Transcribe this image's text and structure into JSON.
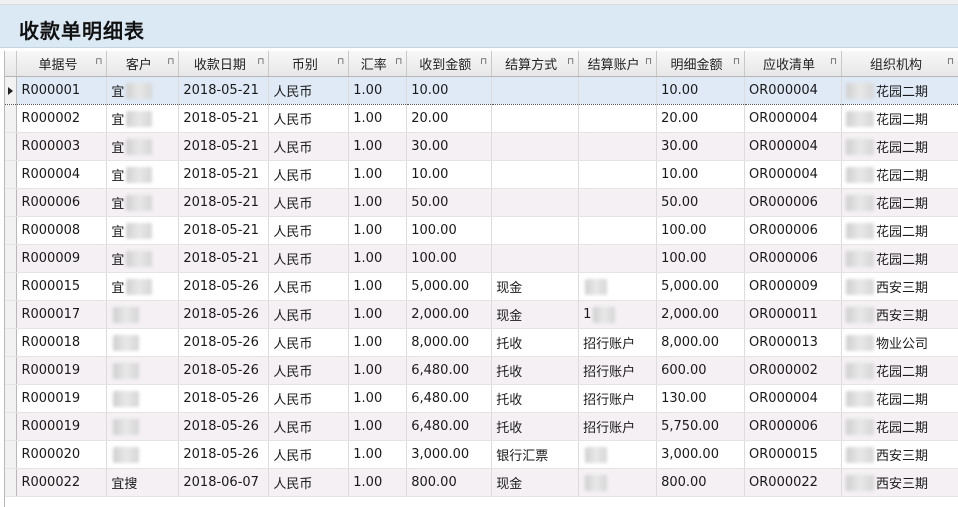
{
  "window": {
    "title": "收款单明细表"
  },
  "columns": [
    {
      "key": "doc_no",
      "label": "单据号"
    },
    {
      "key": "customer",
      "label": "客户"
    },
    {
      "key": "date",
      "label": "收款日期"
    },
    {
      "key": "currency",
      "label": "币别"
    },
    {
      "key": "rate",
      "label": "汇率"
    },
    {
      "key": "received",
      "label": "收到金额"
    },
    {
      "key": "settle_method",
      "label": "结算方式"
    },
    {
      "key": "settle_account",
      "label": "结算账户"
    },
    {
      "key": "detail_amount",
      "label": "明细金额"
    },
    {
      "key": "receivable",
      "label": "应收清单"
    },
    {
      "key": "org",
      "label": "组织机构"
    }
  ],
  "pin_glyph": "⊓",
  "rows": [
    {
      "doc_no": "R000001",
      "customer": "宜",
      "date": "2018-05-21",
      "currency": "人民币",
      "rate": "1.00",
      "received": "10.00",
      "settle_method": "",
      "settle_account": "",
      "detail_amount": "10.00",
      "receivable": "OR000004",
      "org": "花园二期",
      "selected": true
    },
    {
      "doc_no": "R000002",
      "customer": "宜",
      "date": "2018-05-21",
      "currency": "人民币",
      "rate": "1.00",
      "received": "20.00",
      "settle_method": "",
      "settle_account": "",
      "detail_amount": "20.00",
      "receivable": "OR000004",
      "org": "花园二期"
    },
    {
      "doc_no": "R000003",
      "customer": "宜",
      "date": "2018-05-21",
      "currency": "人民币",
      "rate": "1.00",
      "received": "30.00",
      "settle_method": "",
      "settle_account": "",
      "detail_amount": "30.00",
      "receivable": "OR000004",
      "org": "花园二期"
    },
    {
      "doc_no": "R000004",
      "customer": "宜",
      "date": "2018-05-21",
      "currency": "人民币",
      "rate": "1.00",
      "received": "10.00",
      "settle_method": "",
      "settle_account": "",
      "detail_amount": "10.00",
      "receivable": "OR000004",
      "org": "花园二期"
    },
    {
      "doc_no": "R000006",
      "customer": "宜",
      "date": "2018-05-21",
      "currency": "人民币",
      "rate": "1.00",
      "received": "50.00",
      "settle_method": "",
      "settle_account": "",
      "detail_amount": "50.00",
      "receivable": "OR000006",
      "org": "花园二期"
    },
    {
      "doc_no": "R000008",
      "customer": "宜",
      "date": "2018-05-21",
      "currency": "人民币",
      "rate": "1.00",
      "received": "100.00",
      "settle_method": "",
      "settle_account": "",
      "detail_amount": "100.00",
      "receivable": "OR000006",
      "org": "花园二期"
    },
    {
      "doc_no": "R000009",
      "customer": "宜",
      "date": "2018-05-21",
      "currency": "人民币",
      "rate": "1.00",
      "received": "100.00",
      "settle_method": "",
      "settle_account": "",
      "detail_amount": "100.00",
      "receivable": "OR000006",
      "org": "花园二期"
    },
    {
      "doc_no": "R000015",
      "customer": "宜",
      "date": "2018-05-26",
      "currency": "人民币",
      "rate": "1.00",
      "received": "5,000.00",
      "settle_method": "现金",
      "settle_account": "",
      "detail_amount": "5,000.00",
      "receivable": "OR000009",
      "org": "西安三期"
    },
    {
      "doc_no": "R000017",
      "customer": "",
      "date": "2018-05-26",
      "currency": "人民币",
      "rate": "1.00",
      "received": "2,000.00",
      "settle_method": "现金",
      "settle_account": "1",
      "detail_amount": "2,000.00",
      "receivable": "OR000011",
      "org": "西安三期"
    },
    {
      "doc_no": "R000018",
      "customer": "",
      "date": "2018-05-26",
      "currency": "人民币",
      "rate": "1.00",
      "received": "8,000.00",
      "settle_method": "托收",
      "settle_account": "招行账户",
      "detail_amount": "8,000.00",
      "receivable": "OR000013",
      "org": "物业公司"
    },
    {
      "doc_no": "R000019",
      "customer": "",
      "date": "2018-05-26",
      "currency": "人民币",
      "rate": "1.00",
      "received": "6,480.00",
      "settle_method": "托收",
      "settle_account": "招行账户",
      "detail_amount": "600.00",
      "receivable": "OR000002",
      "org": "花园二期"
    },
    {
      "doc_no": "R000019",
      "customer": "",
      "date": "2018-05-26",
      "currency": "人民币",
      "rate": "1.00",
      "received": "6,480.00",
      "settle_method": "托收",
      "settle_account": "招行账户",
      "detail_amount": "130.00",
      "receivable": "OR000004",
      "org": "花园二期"
    },
    {
      "doc_no": "R000019",
      "customer": "",
      "date": "2018-05-26",
      "currency": "人民币",
      "rate": "1.00",
      "received": "6,480.00",
      "settle_method": "托收",
      "settle_account": "招行账户",
      "detail_amount": "5,750.00",
      "receivable": "OR000006",
      "org": "花园二期"
    },
    {
      "doc_no": "R000020",
      "customer": "",
      "date": "2018-05-26",
      "currency": "人民币",
      "rate": "1.00",
      "received": "3,000.00",
      "settle_method": "银行汇票",
      "settle_account": "",
      "detail_amount": "3,000.00",
      "receivable": "OR000015",
      "org": "西安三期"
    },
    {
      "doc_no": "R000022",
      "customer": "宜搜",
      "date": "2018-06-07",
      "currency": "人民币",
      "rate": "1.00",
      "received": "800.00",
      "settle_method": "现金",
      "settle_account": "",
      "detail_amount": "800.00",
      "receivable": "OR000022",
      "org": "西安三期"
    }
  ]
}
